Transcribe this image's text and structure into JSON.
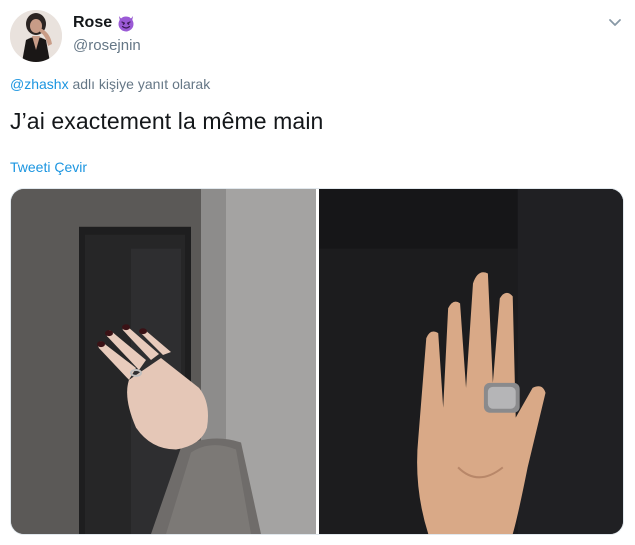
{
  "user": {
    "display_name": "Rose",
    "name_emoji": "smiling-imp-emoji",
    "handle": "@rosejnin"
  },
  "reply": {
    "mention": "@zhashx",
    "suffix": " adlı kişiye yanıt olarak"
  },
  "tweet": {
    "text": "J’ai exactement la même main",
    "translate_label": "Tweeti Çevir"
  },
  "media": {
    "photos": [
      {
        "icon": "hand-with-ring-photo-left"
      },
      {
        "icon": "palm-with-ring-photo-right"
      }
    ]
  },
  "colors": {
    "link": "#1b95e0",
    "secondary_text": "#657786",
    "primary_text": "#14171a",
    "emoji_purple": "#9b5ad6"
  }
}
